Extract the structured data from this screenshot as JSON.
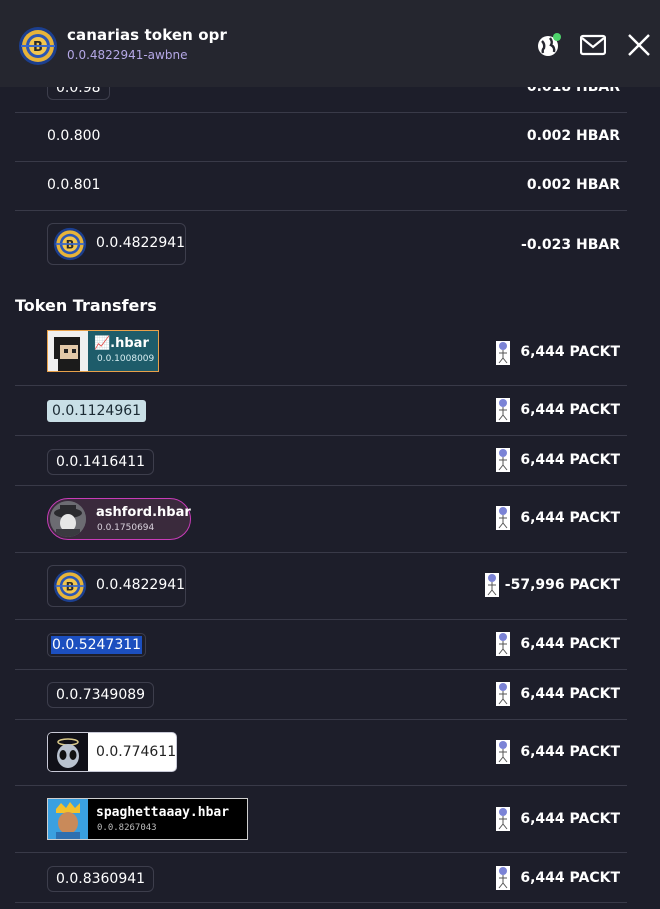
{
  "header": {
    "title": "canarias token opr",
    "account_id": "0.0.4822941-awbne",
    "accent": "#b5a8e6",
    "status_color": "#4ed36b"
  },
  "hbar_transfers": [
    {
      "account": "0.0.98",
      "amount": "0.018 HBAR"
    },
    {
      "account": "0.0.800",
      "amount": "0.002 HBAR"
    },
    {
      "account": "0.0.801",
      "amount": "0.002 HBAR"
    },
    {
      "account": "0.0.4822941",
      "amount": "-0.023 HBAR"
    }
  ],
  "token_section_title": "Token Transfers",
  "token_transfers": [
    {
      "name": "📈.hbar",
      "account": "0.0.1008009",
      "amount": "6,444 PACKT"
    },
    {
      "account": "0.0.1124961",
      "amount": "6,444 PACKT"
    },
    {
      "account": "0.0.1416411",
      "amount": "6,444 PACKT"
    },
    {
      "name": "ashford.hbar",
      "account": "0.0.1750694",
      "amount": "6,444 PACKT"
    },
    {
      "account": "0.0.4822941",
      "amount": "-57,996 PACKT"
    },
    {
      "account": "0.0.5247311",
      "amount": "6,444 PACKT"
    },
    {
      "account": "0.0.7349089",
      "amount": "6,444 PACKT"
    },
    {
      "account": "0.0.7746111",
      "amount": "6,444 PACKT"
    },
    {
      "name": "spaghettaaay.hbar",
      "account": "0.0.8267043",
      "amount": "6,444 PACKT"
    },
    {
      "account": "0.0.8360941",
      "amount": "6,444 PACKT"
    }
  ]
}
